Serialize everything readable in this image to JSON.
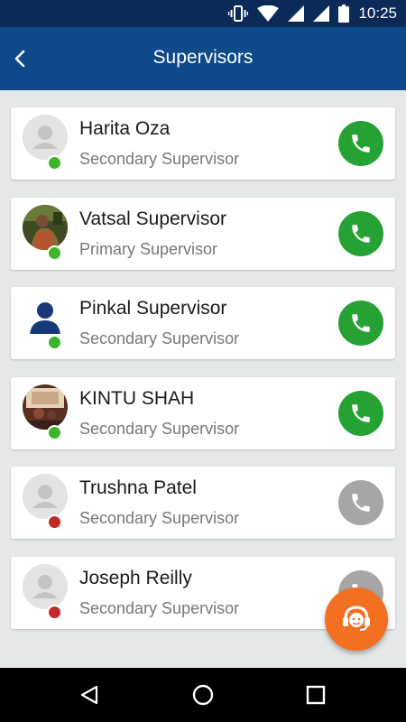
{
  "status_bar": {
    "time": "10:25"
  },
  "header": {
    "title": "Supervisors"
  },
  "supervisors": [
    {
      "name": "Harita Oza",
      "role": "Secondary Supervisor",
      "online": true,
      "avatar": "placeholder"
    },
    {
      "name": "Vatsal Supervisor",
      "role": "Primary Supervisor",
      "online": true,
      "avatar": "photo"
    },
    {
      "name": "Pinkal Supervisor",
      "role": "Secondary Supervisor",
      "online": true,
      "avatar": "person-icon"
    },
    {
      "name": "KINTU SHAH",
      "role": "Secondary Supervisor",
      "online": true,
      "avatar": "photo"
    },
    {
      "name": "Trushna Patel",
      "role": "Secondary Supervisor",
      "online": false,
      "avatar": "placeholder"
    },
    {
      "name": "Joseph Reilly",
      "role": "Secondary Supervisor",
      "online": false,
      "avatar": "placeholder"
    }
  ],
  "colors": {
    "status_bar": "#0b2a57",
    "app_bar": "#0e4a8a",
    "online": "#3cb52c",
    "offline": "#c62828",
    "call_active": "#26a234",
    "call_inactive": "#a6a6a6",
    "fab": "#f36f21"
  },
  "icons": {
    "back": "chevron-left-icon",
    "call": "phone-icon",
    "fab": "support-agent-icon",
    "nav_back": "triangle-back-icon",
    "nav_home": "circle-home-icon",
    "nav_recents": "square-recents-icon"
  }
}
